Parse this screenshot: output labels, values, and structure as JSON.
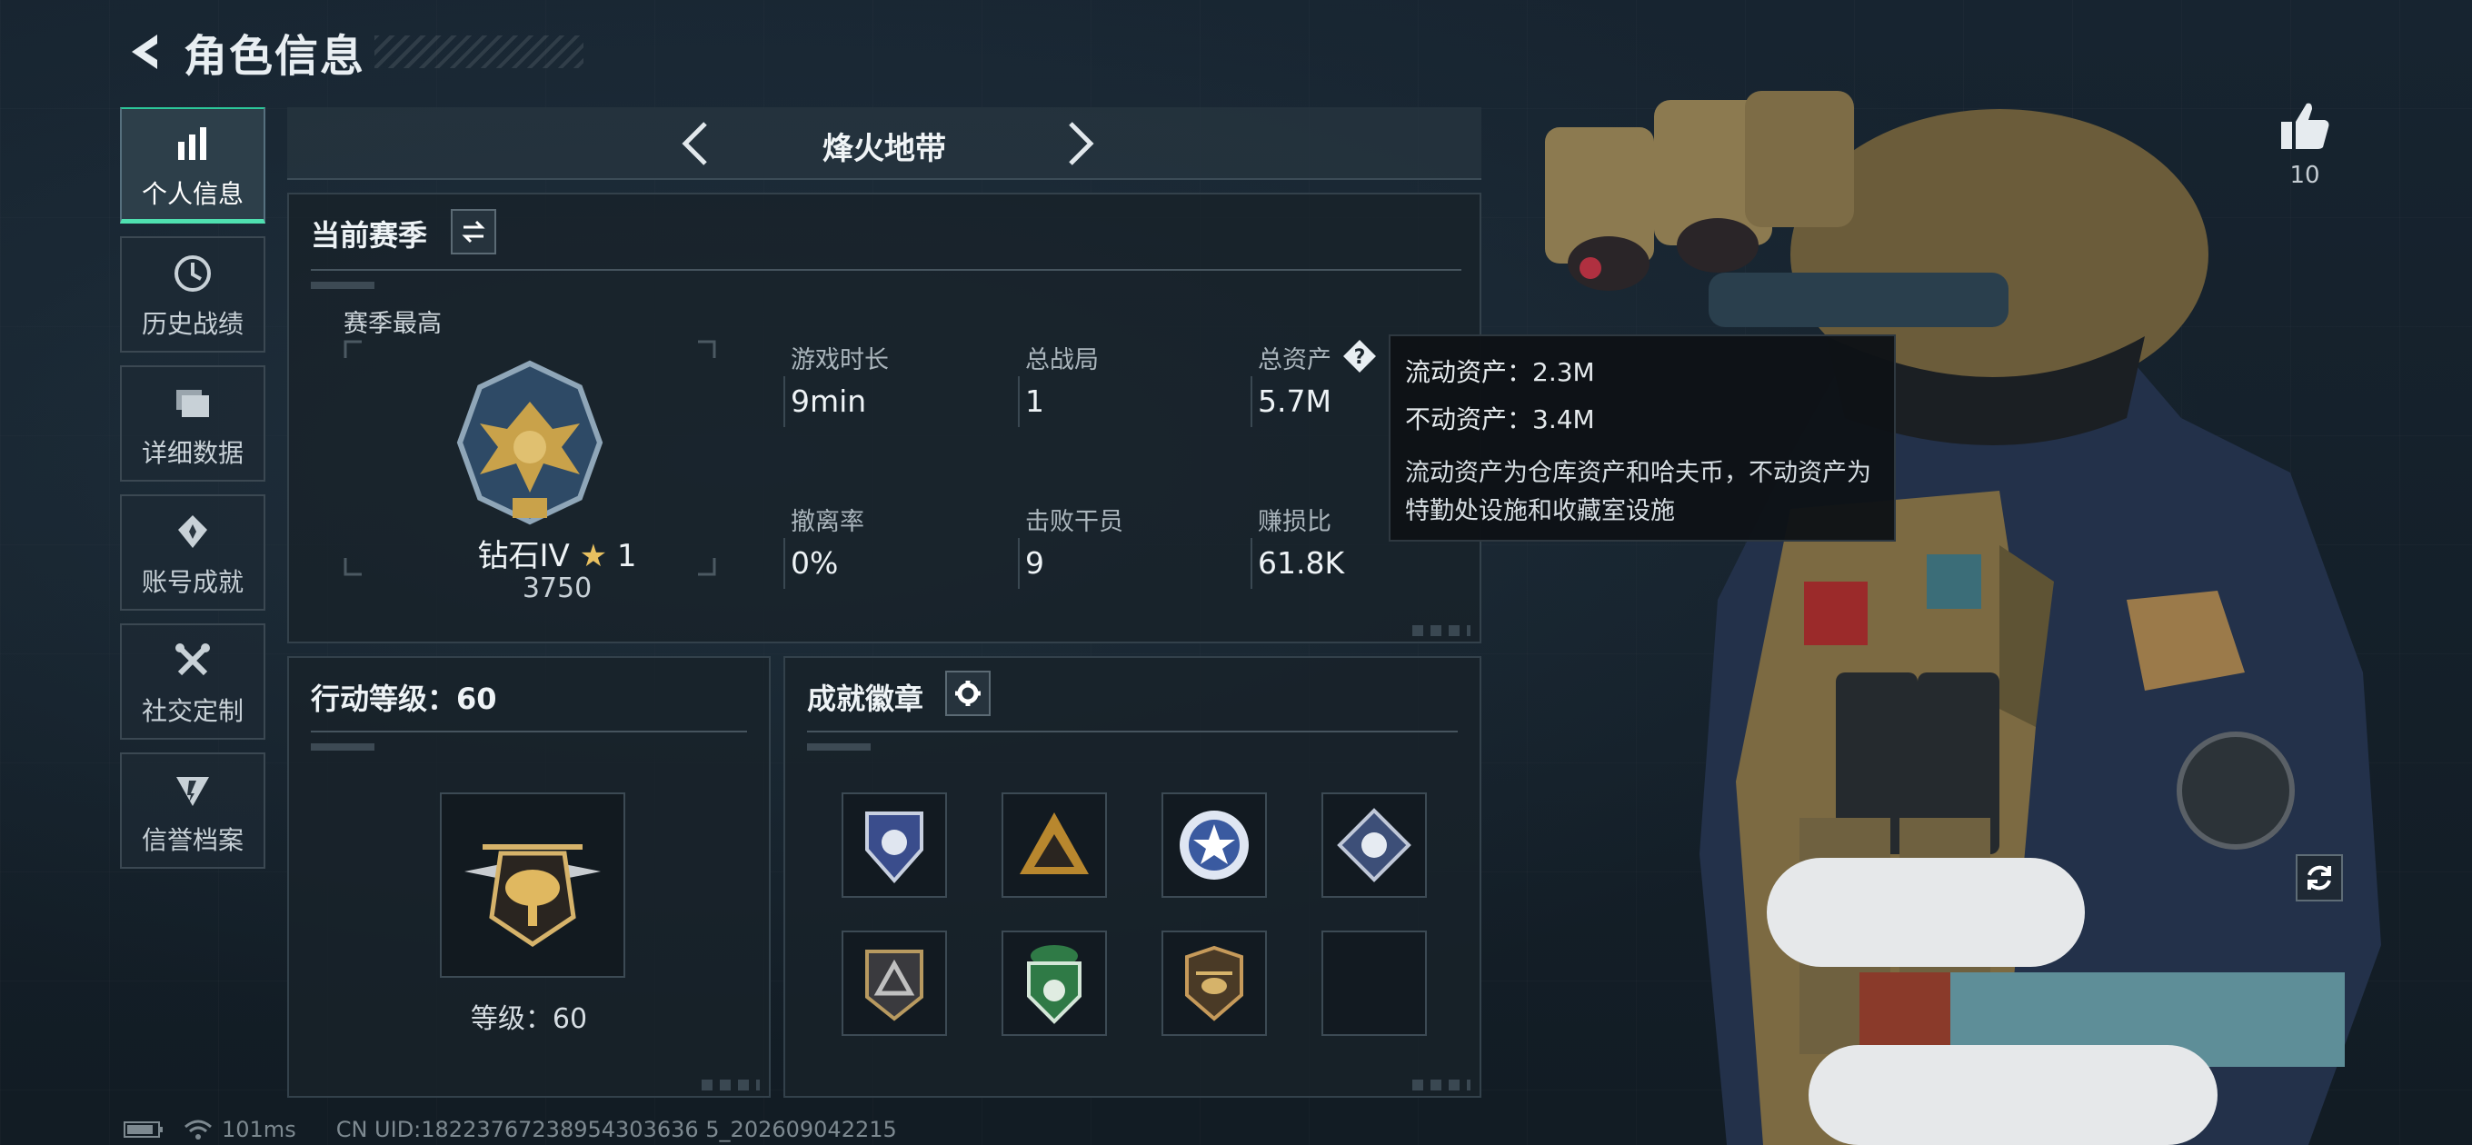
{
  "header": {
    "title": "角色信息"
  },
  "sidebar": {
    "items": [
      {
        "label": "个人信息",
        "icon": "bar-chart-icon",
        "active": true
      },
      {
        "label": "历史战绩",
        "icon": "clock-icon"
      },
      {
        "label": "详细数据",
        "icon": "folder-icon"
      },
      {
        "label": "账号成就",
        "icon": "achievement-icon"
      },
      {
        "label": "社交定制",
        "icon": "tools-icon"
      },
      {
        "label": "信誉档案",
        "icon": "credit-icon"
      }
    ]
  },
  "season": {
    "name": "烽火地带"
  },
  "current_season": {
    "title": "当前赛季",
    "best_label": "赛季最高",
    "rank_name": "钻石IV",
    "rank_stars": "1",
    "rank_points": "3750",
    "stats": [
      {
        "label": "游戏时长",
        "value": "9min"
      },
      {
        "label": "总战局",
        "value": "1"
      },
      {
        "label": "总资产",
        "value": "5.7M"
      },
      {
        "label": "撤离率",
        "value": "0%"
      },
      {
        "label": "击败干员",
        "value": "9"
      },
      {
        "label": "赚损比",
        "value": "61.8K"
      }
    ]
  },
  "tooltip": {
    "liquid": "流动资产：2.3M",
    "fixed": "不动资产：3.4M",
    "description": "流动资产为仓库资产和哈夫币，不动资产为特勤处设施和收藏室设施"
  },
  "action_level": {
    "title": "行动等级：60",
    "level_text": "等级：60"
  },
  "badges": {
    "title": "成就徽章",
    "slots": [
      {
        "icon": "shield-badge-icon"
      },
      {
        "icon": "mountain-badge-icon"
      },
      {
        "icon": "star-badge-icon"
      },
      {
        "icon": "diamond-badge-icon"
      },
      {
        "icon": "triangle-badge-icon"
      },
      {
        "icon": "green-shield-badge-icon"
      },
      {
        "icon": "helicopter-badge-icon"
      },
      {
        "icon": "empty-slot"
      }
    ]
  },
  "likes": {
    "count": "10"
  },
  "status": {
    "ping": "101ms",
    "uid": "CN UID:18223767238954303636 5_202609042215"
  },
  "colors": {
    "accent": "#4fe0b0",
    "panel": "#18222a",
    "background": "#152029"
  }
}
